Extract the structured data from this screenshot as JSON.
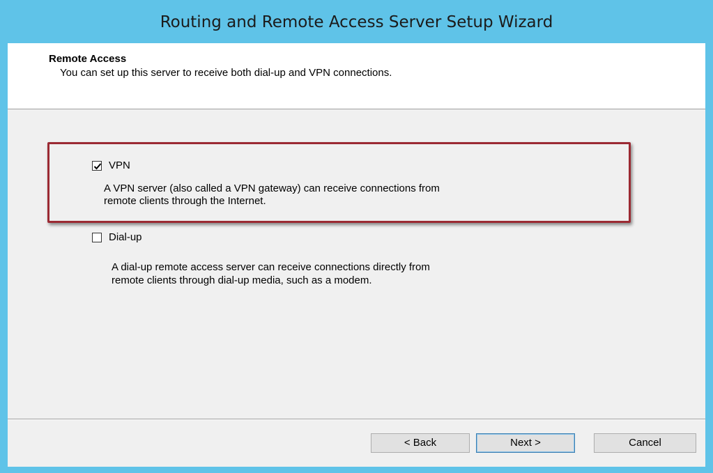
{
  "window": {
    "title": "Routing and Remote Access Server Setup Wizard"
  },
  "header": {
    "title": "Remote Access",
    "subtitle": "You can set up this server to receive both dial-up and VPN connections."
  },
  "options": {
    "vpn": {
      "label": "VPN",
      "checked": true,
      "description_line1": "A VPN server (also called a VPN gateway) can receive connections from",
      "description_line2": "remote clients through the Internet."
    },
    "dialup": {
      "label": "Dial-up",
      "checked": false,
      "description_line1": "A dial-up remote access server can receive connections directly from",
      "description_line2": "remote clients through dial-up media, such as a modem."
    }
  },
  "buttons": {
    "back": "< Back",
    "next": "Next >",
    "cancel": "Cancel"
  },
  "colors": {
    "title_bar": "#5fc3e8",
    "highlight": "#9b2a33",
    "client_bg": "#f0f0f0"
  }
}
